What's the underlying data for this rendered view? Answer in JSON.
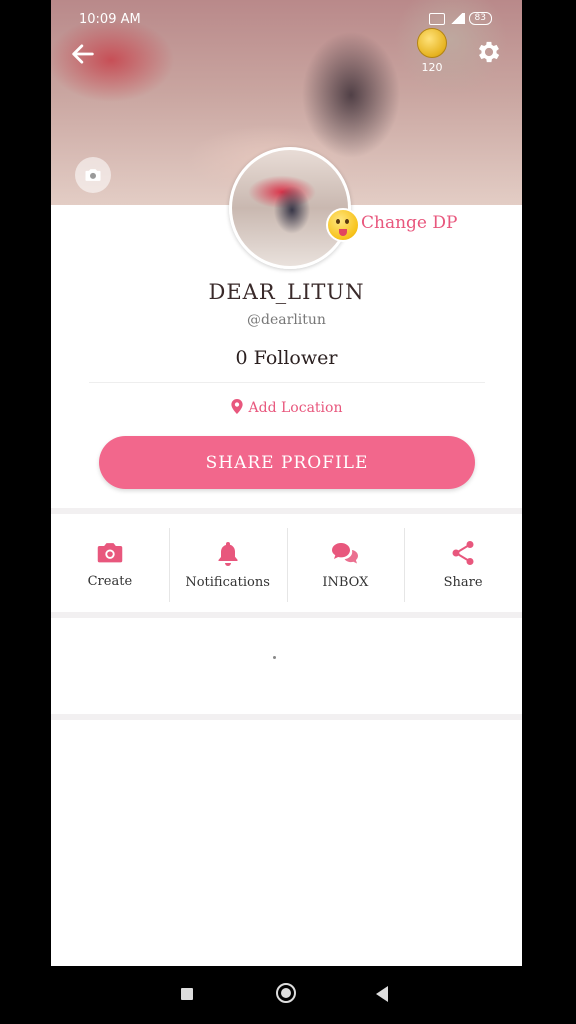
{
  "status_bar": {
    "time": "10:09 AM",
    "battery": "83"
  },
  "header": {
    "coins": "120"
  },
  "profile": {
    "change_dp_label": "Change DP",
    "display_name": "DEAR_LITUN",
    "handle": "@dearlitun",
    "followers": "0 Follower",
    "add_location_label": "Add Location",
    "share_profile_label": "SHARE PROFILE"
  },
  "actions": [
    {
      "label": "Create",
      "icon": "camera-icon"
    },
    {
      "label": "Notifications",
      "icon": "bell-icon"
    },
    {
      "label": "INBOX",
      "icon": "chat-icon"
    },
    {
      "label": "Share",
      "icon": "share-icon"
    }
  ],
  "colors": {
    "accent": "#f2678c",
    "accent_text": "#e8577d"
  }
}
